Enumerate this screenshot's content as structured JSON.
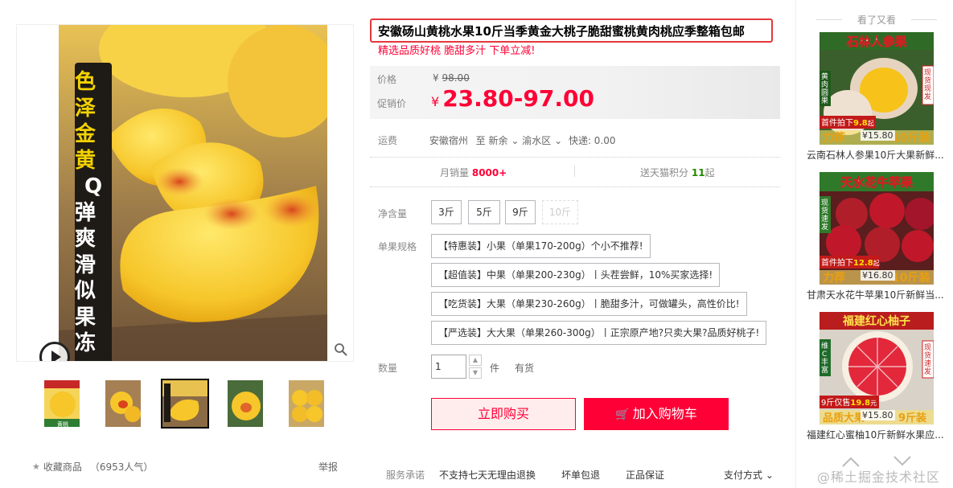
{
  "gallery": {
    "main_image": {
      "banner_lines": [
        "色泽",
        "金黄",
        "Q",
        "弹爽",
        "滑似",
        "果冻"
      ]
    },
    "thumbnails": [
      {
        "id": "thumb-1",
        "caption": "黄桃"
      },
      {
        "id": "thumb-2",
        "caption": ""
      },
      {
        "id": "thumb-3",
        "caption": "",
        "active": true
      },
      {
        "id": "thumb-4",
        "caption": ""
      },
      {
        "id": "thumb-5",
        "caption": ""
      }
    ],
    "favorite_label": "收藏商品",
    "popularity": "（6953人气）",
    "report_label": "举报"
  },
  "product": {
    "title": "安徽砀山黄桃水果10斤当季黄金大桃子脆甜蜜桃黄肉桃应季整箱包邮",
    "subtitle": "精选品质好桃 脆甜多汁 下单立减!",
    "price_label": "价格",
    "original_price_currency": "¥",
    "original_price": "98.00",
    "promo_label": "促销价",
    "promo_currency": "¥",
    "promo_price": "23.80-97.00",
    "shipping_label": "运费",
    "ship_from": "安徽宿州",
    "ship_to_prefix": "至",
    "ship_to_city": "新余",
    "ship_to_district": "渝水区",
    "express": "快递: 0.00",
    "monthly_sales_label": "月销量",
    "monthly_sales": "8000+",
    "points_label": "送天猫积分",
    "points": "11",
    "points_unit": "起",
    "net_weight_label": "净含量",
    "net_weights": [
      {
        "label": "3斤",
        "disabled": false
      },
      {
        "label": "5斤",
        "disabled": false
      },
      {
        "label": "9斤",
        "disabled": false
      },
      {
        "label": "10斤",
        "disabled": true
      }
    ],
    "fruit_spec_label": "单果规格",
    "fruit_specs": [
      "【特惠装】小果（单果170-200g）个小不推荐!",
      "【超值装】中果（单果200-230g）丨头茬尝鲜，10%买家选择!",
      "【吃货装】大果（单果230-260g）丨脆甜多汁，可做罐头，高性价比!",
      "【严选装】大大果（单果260-300g）丨正宗原产地?只卖大果?品质好桃子!"
    ],
    "quantity_label": "数量",
    "quantity_value": "1",
    "quantity_unit": "件",
    "stock_status": "有货",
    "buy_now": "立即购买",
    "add_to_cart": "加入购物车",
    "service_label": "服务承诺",
    "services": [
      "不支持七天无理由退换",
      "坏单包退",
      "正品保证"
    ],
    "payment_label": "支付方式"
  },
  "recommendations": {
    "heading": "看了又看",
    "items": [
      {
        "image_title": "石林人参果",
        "badge_left": "黄肉圆果",
        "badge_right": "现货现发",
        "promo_strip": "首件拍下",
        "promo_price": "9.8",
        "promo_suffix": "起",
        "bottom_text": "力荐",
        "bottom_text2": "10斤装",
        "price": "¥15.80",
        "title": "云南石林人参果10斤大果新鲜..."
      },
      {
        "image_title": "天水花牛苹果",
        "badge_left": "现货速发",
        "badge_right": "",
        "promo_strip": "首件拍下",
        "promo_price": "12.8",
        "promo_suffix": "起",
        "bottom_text": "力荐",
        "bottom_text2": "10斤装",
        "price": "¥16.80",
        "title": "甘肃天水花牛苹果10斤新鲜当..."
      },
      {
        "image_title": "福建红心柚子",
        "badge_left": "维C丰富",
        "badge_right": "现货速发",
        "promo_strip": "9斤仅售",
        "promo_price": "19.8",
        "promo_suffix": "元",
        "bottom_text": "品质大果",
        "bottom_text2": "9斤装",
        "price": "¥15.80",
        "title": "福建红心蜜柚10斤新鲜水果应..."
      }
    ]
  },
  "watermark": "@稀土掘金技术社区",
  "colors": {
    "brand_red": "#ff0036",
    "title_border": "#e4393c",
    "peach_yellow": "#f6c62a"
  }
}
